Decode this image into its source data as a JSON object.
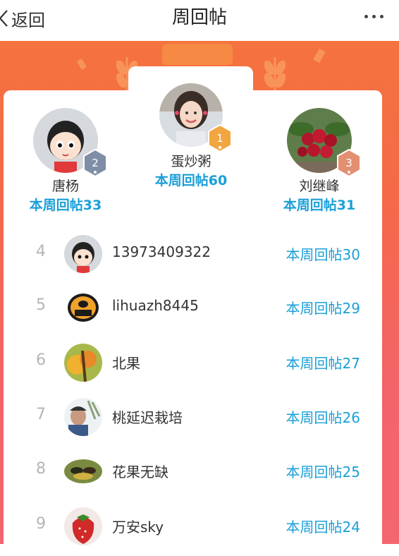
{
  "nav": {
    "back_label": "返回",
    "title": "周回帖",
    "back_icon": "chevron-left-icon",
    "more_icon": "more-dots-icon"
  },
  "colors": {
    "banner": "#f46a48",
    "accent_blue": "#1a9fd8",
    "rank_gray": "#b5b5b5",
    "gold_badge": "#f2a640",
    "silver_badge": "#7f8ea6",
    "bronze_badge": "#e38f72"
  },
  "podium": [
    {
      "rank": "1",
      "name": "蛋炒粥",
      "count": "本周回帖60"
    },
    {
      "rank": "2",
      "name": "唐杨",
      "count": "本周回帖33"
    },
    {
      "rank": "3",
      "name": "刘继峰",
      "count": "本周回帖31"
    }
  ],
  "list": [
    {
      "rank": "4",
      "name": "13973409322",
      "count": "本周回帖30"
    },
    {
      "rank": "5",
      "name": "lihuazh8445",
      "count": "本周回帖29"
    },
    {
      "rank": "6",
      "name": "北果",
      "count": "本周回帖27"
    },
    {
      "rank": "7",
      "name": "桃延迟栽培",
      "count": "本周回帖26"
    },
    {
      "rank": "8",
      "name": "花果无缺",
      "count": "本周回帖25"
    },
    {
      "rank": "9",
      "name": "万安sky",
      "count": "本周回帖24"
    }
  ]
}
